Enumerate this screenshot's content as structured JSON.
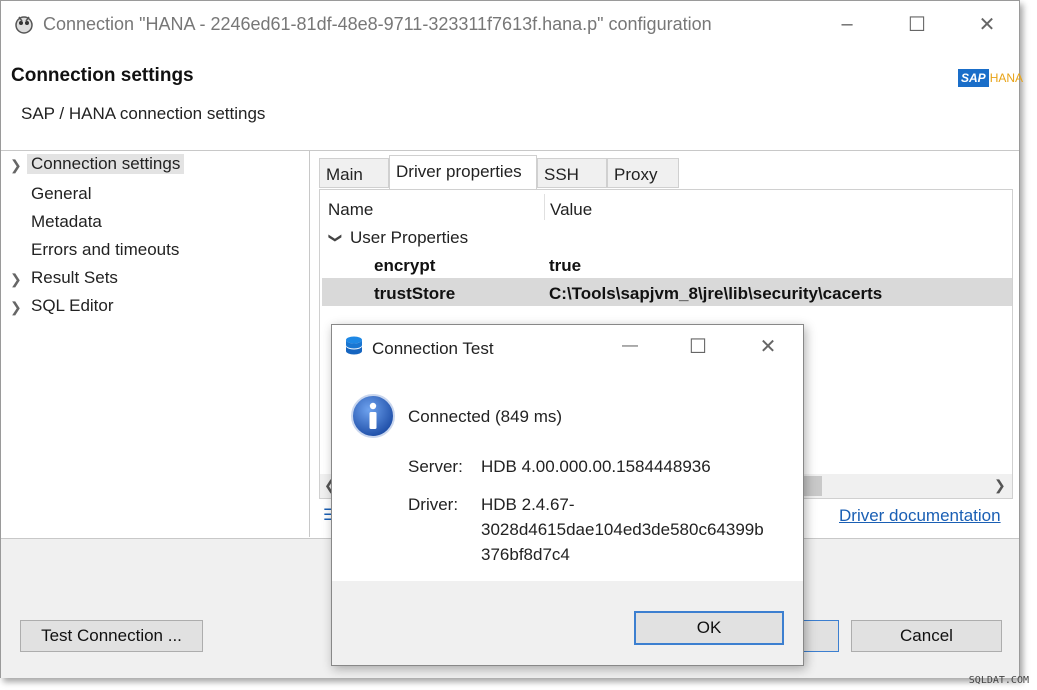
{
  "window": {
    "title": "Connection \"HANA - 2246ed61-81df-48e8-9711-323311f7613f.hana.p\" configuration",
    "minimize": "–",
    "maximize": "☐",
    "close": "✕"
  },
  "header": {
    "title": "Connection settings",
    "subtitle": "SAP / HANA connection settings",
    "logo_sap": "SAP",
    "logo_hana": "HANA"
  },
  "tree": {
    "items": [
      {
        "label": "Connection settings",
        "expandable": true,
        "selected": true
      },
      {
        "label": "General"
      },
      {
        "label": "Metadata"
      },
      {
        "label": "Errors and timeouts"
      },
      {
        "label": "Result Sets",
        "expandable": true
      },
      {
        "label": "SQL Editor",
        "expandable": true
      }
    ]
  },
  "tabs": [
    "Main",
    "Driver properties",
    "SSH",
    "Proxy"
  ],
  "properties": {
    "col_name": "Name",
    "col_value": "Value",
    "group": "User Properties",
    "rows": [
      {
        "name": "encrypt",
        "value": "true"
      },
      {
        "name": "trustStore",
        "value": "C:\\Tools\\sapjvm_8\\jre\\lib\\security\\cacerts"
      }
    ]
  },
  "driver_doc_link": "Driver documentation",
  "buttons": {
    "test_connection": "Test Connection ...",
    "cancel": "Cancel"
  },
  "dialog": {
    "title": "Connection Test",
    "message": "Connected (849 ms)",
    "server_label": "Server:",
    "server_value": "HDB 4.00.000.00.1584448936",
    "driver_label": "Driver:",
    "driver_value_1": "HDB 2.4.67-",
    "driver_value_2": "3028d4615dae104ed3de580c64399b",
    "driver_value_3": "376bf8d7c4",
    "ok": "OK",
    "minimize": "—",
    "maximize": "☐",
    "close": "✕"
  },
  "watermark": "SQLDAT.COM",
  "colors": {
    "accent": "#1a5fb4",
    "selection": "#d9d9d9",
    "info_icon": "#1f4fa8"
  }
}
